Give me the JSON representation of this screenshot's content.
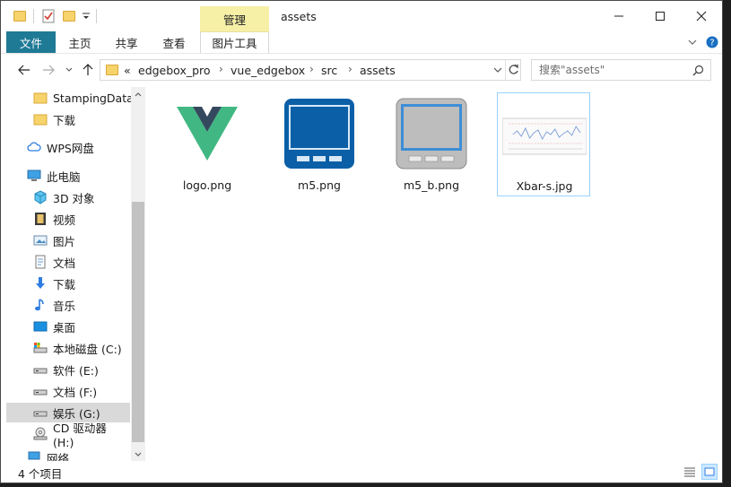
{
  "window": {
    "title": "assets",
    "context_tab": "管理",
    "accent_color": "#1f7a95",
    "context_color": "#f6efa6"
  },
  "ribbon": {
    "tabs": [
      "文件",
      "主页",
      "共享",
      "查看",
      "图片工具"
    ]
  },
  "address": {
    "overflow": "«",
    "crumbs": [
      "edgebox_pro",
      "vue_edgebox",
      "src",
      "assets"
    ],
    "search_placeholder": "搜索\"assets\""
  },
  "sidebar": {
    "items": [
      {
        "label": "StampingData",
        "icon": "folder-icon"
      },
      {
        "label": "下载",
        "icon": "folder-icon"
      },
      {
        "label": "WPS网盘",
        "icon": "cloud-icon"
      },
      {
        "label": "此电脑",
        "icon": "computer-icon"
      },
      {
        "label": "3D 对象",
        "icon": "cube-icon"
      },
      {
        "label": "视频",
        "icon": "video-icon"
      },
      {
        "label": "图片",
        "icon": "picture-icon"
      },
      {
        "label": "文档",
        "icon": "document-icon"
      },
      {
        "label": "下载",
        "icon": "download-icon"
      },
      {
        "label": "音乐",
        "icon": "music-icon"
      },
      {
        "label": "桌面",
        "icon": "desktop-icon"
      },
      {
        "label": "本地磁盘 (C:)",
        "icon": "drive-icon"
      },
      {
        "label": "软件 (E:)",
        "icon": "drive-icon"
      },
      {
        "label": "文档 (F:)",
        "icon": "drive-icon"
      },
      {
        "label": "娱乐 (G:)",
        "icon": "drive-icon",
        "selected": true
      },
      {
        "label": "CD 驱动器 (H:)",
        "icon": "cd-drive-icon"
      },
      {
        "label": "网络",
        "icon": "network-icon"
      }
    ]
  },
  "files": [
    {
      "name": "logo.png",
      "thumbnail": "vue-logo-icon"
    },
    {
      "name": "m5.png",
      "thumbnail": "device-blue-icon"
    },
    {
      "name": "m5_b.png",
      "thumbnail": "device-gray-icon"
    },
    {
      "name": "Xbar-s.jpg",
      "thumbnail": "chart-thumbnail-icon",
      "selected": true
    }
  ],
  "status": {
    "item_count": "4 个项目"
  }
}
